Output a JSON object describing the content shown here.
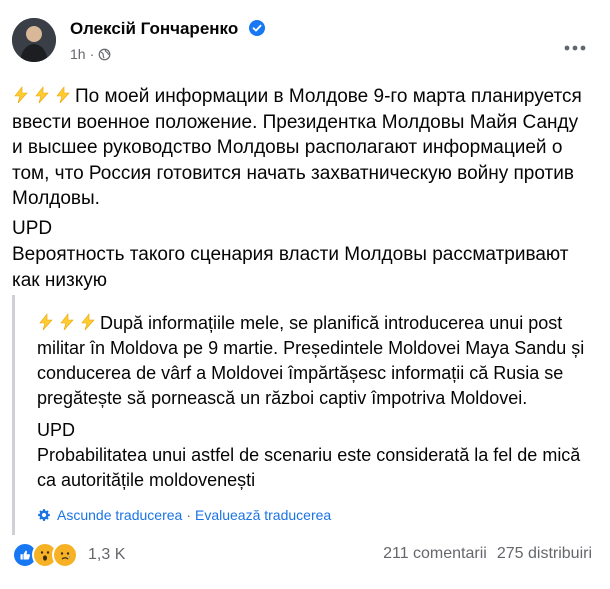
{
  "header": {
    "author": "Олексій Гончаренко",
    "time": "1h",
    "separator": "·"
  },
  "post": {
    "paragraph1": "По моей информации в Молдове 9-го марта планируется ввести военное положение. Президентка Молдовы Майя Санду и высшее руководство Молдовы располагают информацией о том, что Россия готовится начать захватническую войну против Молдовы.",
    "upd": "UPD",
    "paragraph2": "Вероятность такого сценария власти Молдовы рассматривают как низкую"
  },
  "translation": {
    "paragraph1": "După informațiile mele, se planifică introducerea unui post militar în Moldova pe 9 martie. Președintele Moldovei Maya Sandu și conducerea de vârf a Moldovei împărtășesc informații că Rusia se pregătește să pornească un război captiv împotriva Moldovei.",
    "upd": "UPD",
    "paragraph2": "Probabilitatea unui astfel de scenariu este considerată la fel de mică ca autoritățile moldovenești",
    "hide_label": "Ascunde traducerea",
    "separator": "·",
    "rate_label": "Evaluează traducerea"
  },
  "footer": {
    "reaction_count": "1,3 K",
    "comments": "211 comentarii",
    "shares": "275 distribuiri"
  },
  "icons": {
    "more": "more-horiz-icon",
    "verified": "verified-badge-icon",
    "globe": "public-globe-icon",
    "gear": "gear-icon",
    "emoji": "lightning-emoji-icon"
  },
  "colors": {
    "verified": "#1877f2",
    "link": "#1b74e4",
    "secondary": "#65676b",
    "like": "#1877f2",
    "wow": "#f7b125"
  }
}
